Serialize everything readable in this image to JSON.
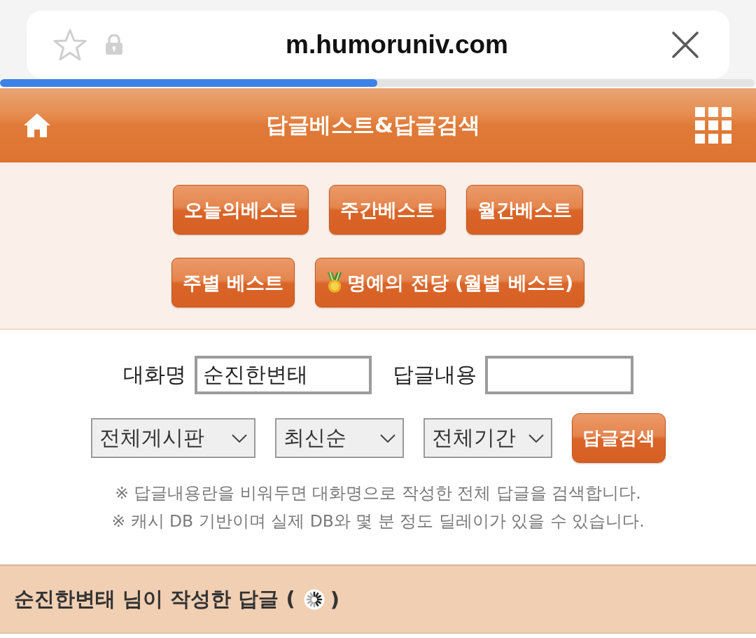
{
  "browser": {
    "url": "m.humoruniv.com",
    "load_progress": {
      "level": 0.5
    }
  },
  "header": {
    "title": "답글베스트&답글검색"
  },
  "best_button_rows": [
    [
      {
        "label": "오늘의베스트",
        "kind": "plain"
      },
      {
        "label": "주간베스트",
        "kind": "plain"
      },
      {
        "label": "월간베스트",
        "kind": "plain"
      }
    ],
    [
      {
        "label": "주별 베스트",
        "kind": "plain"
      },
      {
        "label": "명예의 전당 (월별 베스트)",
        "kind": "medal"
      }
    ]
  ],
  "search": {
    "fields": [
      {
        "label": "대화명",
        "value": "순진한변태"
      },
      {
        "label": "답글내용"
      }
    ],
    "dropdowns": [
      {
        "value": "전체게시판"
      },
      {
        "value": "최신순"
      },
      {
        "value": "전체기간"
      }
    ],
    "submit": "답글검색",
    "notes": [
      "※ 답글내용란을 비워두면 대화명으로 작성한 전체 답글을 검색합니다.",
      "※ 캐시 DB 기반이며 실제 DB와 몇 분 정도 딜레이가 있을 수 있습니다."
    ]
  },
  "results": {
    "title": "순진한변태 님이 작성한 답글 (",
    "title_end": ")",
    "loading": true
  }
}
